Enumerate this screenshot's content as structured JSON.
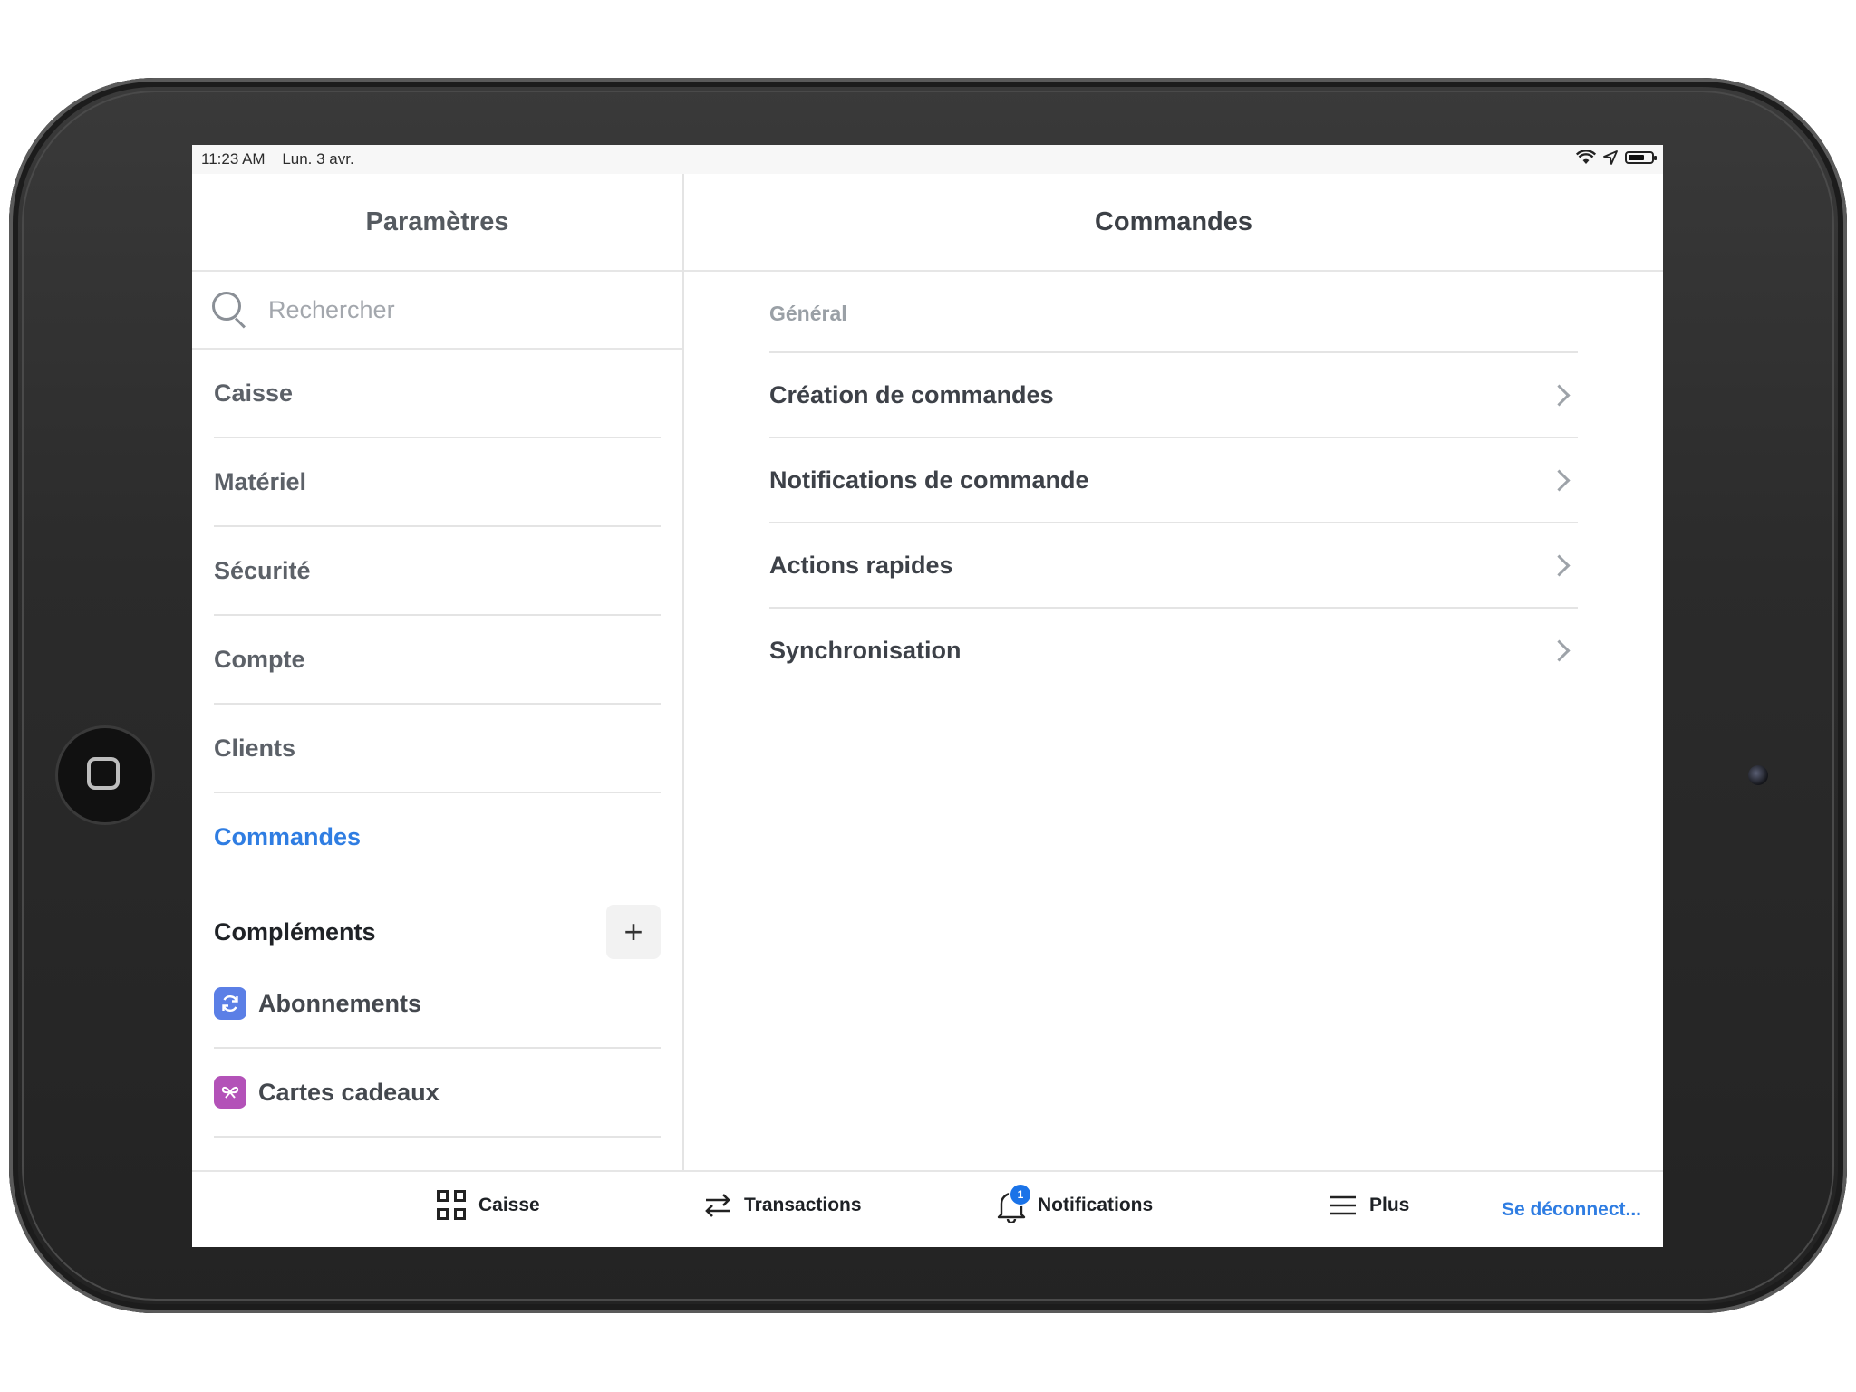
{
  "status_bar": {
    "time": "11:23 AM",
    "date": "Lun. 3 avr."
  },
  "sidebar": {
    "title": "Paramètres",
    "search_placeholder": "Rechercher",
    "items": [
      {
        "label": "Caisse"
      },
      {
        "label": "Matériel"
      },
      {
        "label": "Sécurité"
      },
      {
        "label": "Compte"
      },
      {
        "label": "Clients"
      },
      {
        "label": "Commandes"
      }
    ],
    "addons_title": "Compléments",
    "add_symbol": "+",
    "addons": [
      {
        "label": "Abonnements",
        "icon": "refresh-icon",
        "color": "#5b7fe6"
      },
      {
        "label": "Cartes cadeaux",
        "icon": "gift-icon",
        "color": "#b352b8"
      }
    ]
  },
  "detail": {
    "title": "Commandes",
    "group": "Général",
    "rows": [
      {
        "label": "Création de commandes"
      },
      {
        "label": "Notifications de commande"
      },
      {
        "label": "Actions rapides"
      },
      {
        "label": "Synchronisation"
      }
    ]
  },
  "tabbar": {
    "tabs": [
      {
        "label": "Caisse",
        "icon": "grid-icon"
      },
      {
        "label": "Transactions",
        "icon": "swap-icon"
      },
      {
        "label": "Notifications",
        "icon": "bell-icon",
        "badge": "1"
      },
      {
        "label": "Plus",
        "icon": "menu-icon"
      }
    ],
    "logout": "Se déconnect..."
  },
  "colors": {
    "accent": "#2f7de2",
    "badge": "#1a73e8"
  }
}
